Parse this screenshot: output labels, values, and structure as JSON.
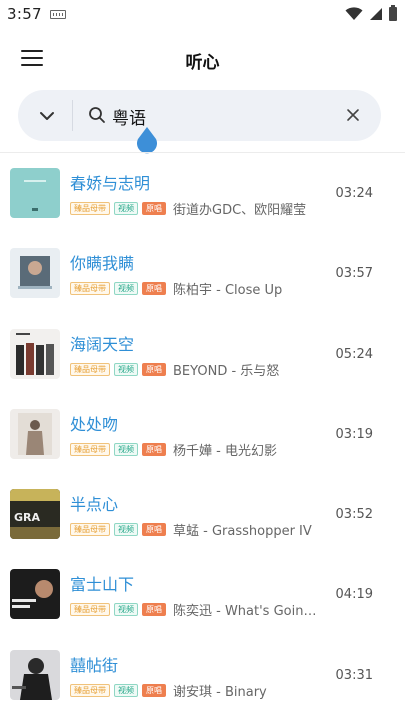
{
  "status_bar": {
    "time": "3:57"
  },
  "header": {
    "title": "听心"
  },
  "search": {
    "query": "粤语"
  },
  "badges": {
    "hq": "臻品母带",
    "video": "视频",
    "original": "原唱"
  },
  "songs": [
    {
      "title": "春娇与志明",
      "artist": "街道办GDC、欧阳耀莹",
      "duration": "03:24"
    },
    {
      "title": "你瞒我瞒",
      "artist": "陈柏宇 - Close Up",
      "duration": "03:57"
    },
    {
      "title": "海阔天空",
      "artist": "BEYOND - 乐与怒",
      "duration": "05:24"
    },
    {
      "title": "处处吻",
      "artist": "杨千嬅 - 电光幻影",
      "duration": "03:19"
    },
    {
      "title": "半点心",
      "artist": "草蜢 - Grasshopper IV",
      "duration": "03:52"
    },
    {
      "title": "富士山下",
      "artist": "陈奕迅 - What's Going...",
      "duration": "04:19"
    },
    {
      "title": "囍帖街",
      "artist": "谢安琪 - Binary",
      "duration": "03:31"
    }
  ]
}
